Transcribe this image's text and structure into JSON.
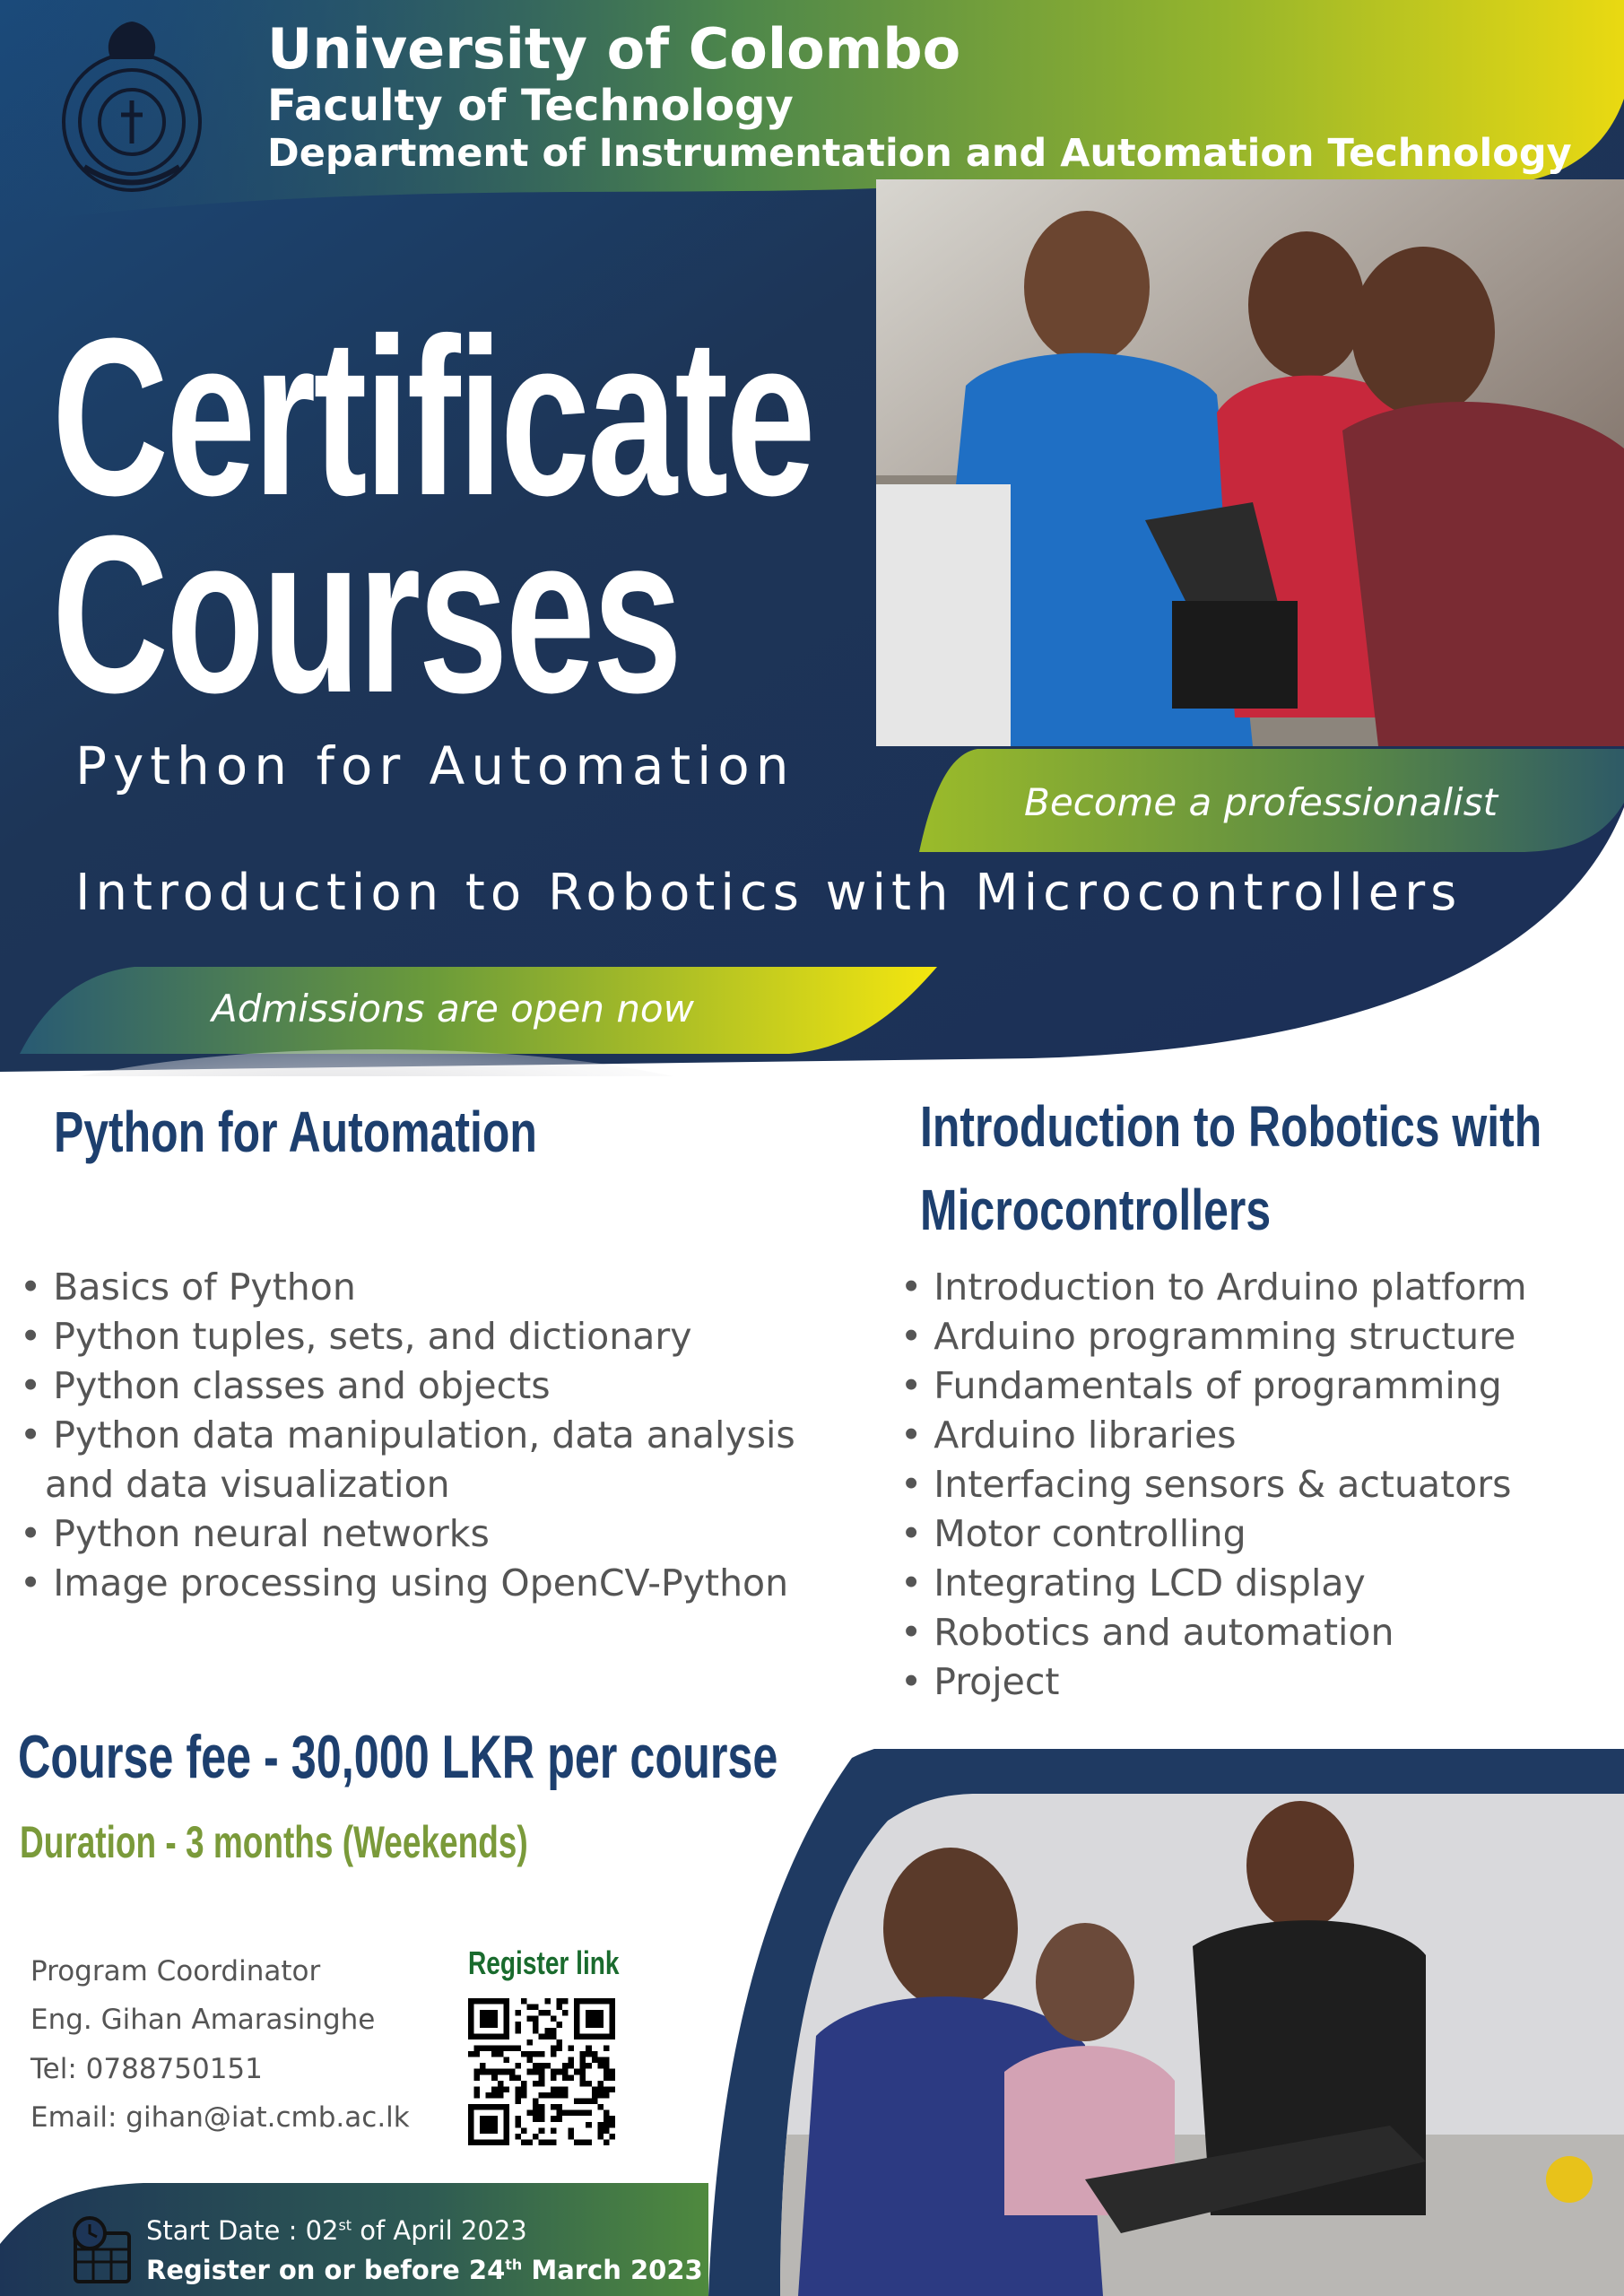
{
  "header": {
    "university": "University of Colombo",
    "faculty": "Faculty of Technology",
    "department": "Department of Instrumentation and Automation Technology"
  },
  "hero": {
    "title_line1": "Certificate",
    "title_line2": "Courses",
    "course1": "Python for Automation",
    "course2": "Introduction to Robotics with Microcontrollers",
    "tagline": "Become a professionalist",
    "admissions": "Admissions are open now"
  },
  "courses": [
    {
      "title": "Python for Automation",
      "items": [
        "Basics of Python",
        "Python tuples, sets, and dictionary",
        "Python classes and objects",
        "Python data manipulation, data analysis and data visualization",
        "Python neural networks",
        "Image processing using OpenCV-Python"
      ]
    },
    {
      "title_line1": "Introduction to Robotics with",
      "title_line2": "Microcontrollers",
      "items": [
        "Introduction to Arduino platform",
        "Arduino programming structure",
        "Fundamentals of programming",
        "Arduino libraries",
        "Interfacing sensors & actuators",
        "Motor controlling",
        "Integrating LCD display",
        "Robotics and automation",
        "Project"
      ]
    }
  ],
  "fee": "Course fee - 30,000 LKR per course",
  "duration": "Duration - 3 months (Weekends)",
  "contact": {
    "role": "Program Coordinator",
    "name": "Eng. Gihan Amarasinghe",
    "tel": "Tel: 0788750151",
    "email": "Email: gihan@iat.cmb.ac.lk"
  },
  "register": {
    "label": "Register link"
  },
  "footer": {
    "start_prefix": "Start Date : 02",
    "start_sup": "st",
    "start_suffix": " of April 2023",
    "reg_prefix": "Register on or before 24",
    "reg_sup": "th",
    "reg_suffix": " March 2023"
  },
  "colors": {
    "navy": "#1d3557",
    "green": "#7ba63a",
    "yellow": "#f2e310",
    "heading_blue": "#1d3f6e",
    "duration_green": "#7a9a3a"
  },
  "icons": [
    "university-crest-icon",
    "qr-code-icon",
    "calendar-clock-icon"
  ]
}
